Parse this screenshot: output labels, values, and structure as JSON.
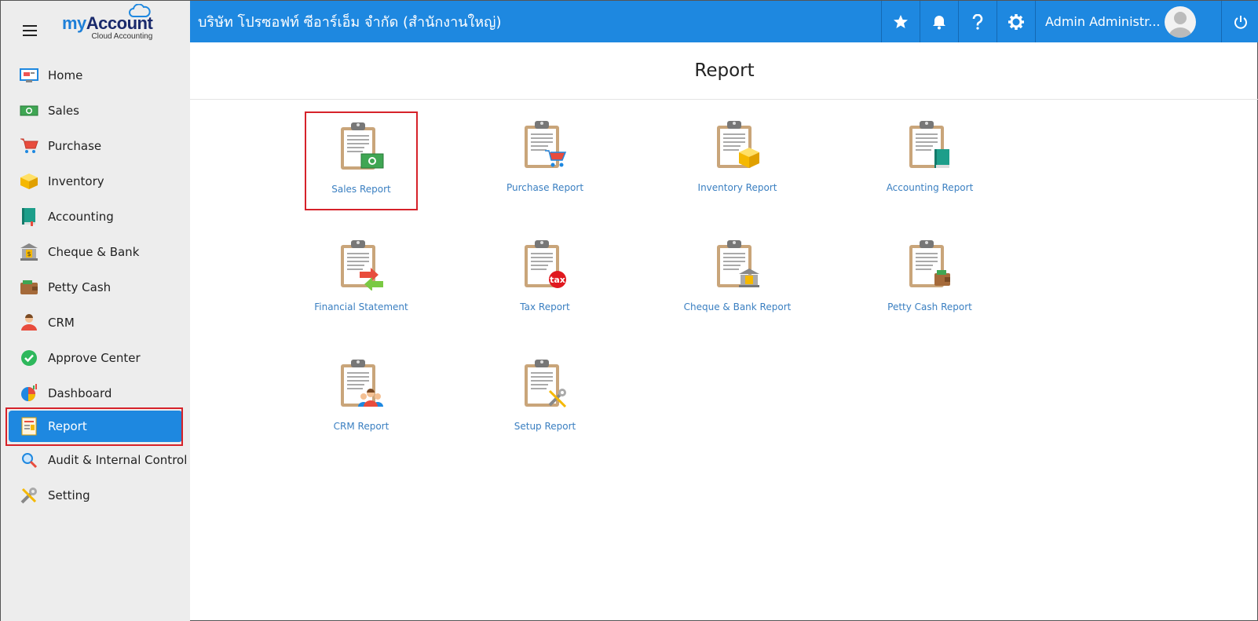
{
  "app": {
    "brand_my": "my",
    "brand_account": "Account",
    "brand_sub": "Cloud Accounting"
  },
  "header": {
    "company": "บริษัท โปรซอฟท์ ซีอาร์เอ็ม จำกัด (สำนักงานใหญ่)",
    "user_name": "Admin Administr...",
    "accent": "#1e88e0"
  },
  "sidebar": {
    "items": [
      {
        "label": "Home",
        "icon": "home-icon"
      },
      {
        "label": "Sales",
        "icon": "sales-money-icon"
      },
      {
        "label": "Purchase",
        "icon": "cart-icon"
      },
      {
        "label": "Inventory",
        "icon": "box-icon"
      },
      {
        "label": "Accounting",
        "icon": "ledger-book-icon"
      },
      {
        "label": "Cheque & Bank",
        "icon": "bank-icon"
      },
      {
        "label": "Petty Cash",
        "icon": "wallet-icon"
      },
      {
        "label": "CRM",
        "icon": "people-icon"
      },
      {
        "label": "Approve Center",
        "icon": "check-circle-icon"
      },
      {
        "label": "Dashboard",
        "icon": "pie-chart-icon"
      },
      {
        "label": "Report",
        "icon": "report-icon",
        "active": true
      },
      {
        "label": "Audit & Internal Control",
        "icon": "magnifier-icon"
      },
      {
        "label": "Setting",
        "icon": "tools-icon"
      }
    ]
  },
  "main": {
    "title": "Report",
    "reports": [
      {
        "label": "Sales Report",
        "badge": "money-icon",
        "selected": true
      },
      {
        "label": "Purchase Report",
        "badge": "cart-icon"
      },
      {
        "label": "Inventory Report",
        "badge": "box-icon"
      },
      {
        "label": "Accounting Report",
        "badge": "book-icon"
      },
      {
        "label": "Financial Statement",
        "badge": "exchange-icon"
      },
      {
        "label": "Tax Report",
        "badge": "tax-icon",
        "badge_text": "tax"
      },
      {
        "label": "Cheque & Bank Report",
        "badge": "bank-icon"
      },
      {
        "label": "Petty Cash Report",
        "badge": "wallet-icon"
      },
      {
        "label": "CRM Report",
        "badge": "people-icon"
      },
      {
        "label": "Setup Report",
        "badge": "tools-icon"
      }
    ]
  }
}
